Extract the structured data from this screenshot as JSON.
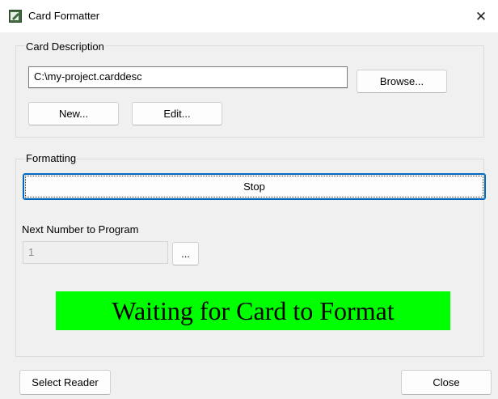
{
  "window": {
    "title": "Card Formatter",
    "close_glyph": "✕"
  },
  "card_description": {
    "group_label": "Card Description",
    "path_value": "C:\\my-project.carddesc",
    "browse_label": "Browse...",
    "new_label": "New...",
    "edit_label": "Edit..."
  },
  "formatting": {
    "group_label": "Formatting",
    "stop_label": "Stop",
    "next_number_label": "Next Number to Program",
    "next_number_value": "1",
    "ellipsis_label": "...",
    "status_text": "Waiting for Card to Format",
    "status_color": "#00ff00"
  },
  "footer": {
    "select_reader_label": "Select Reader",
    "close_label": "Close"
  },
  "icons": {
    "app_icon": "card-formatter-app-icon",
    "close_icon": "close-icon"
  },
  "colors": {
    "titlebar_bg": "#ffffff",
    "window_bg": "#f0f0f0",
    "focus_border": "#0067c0",
    "app_icon_green": "#2e7d32"
  }
}
